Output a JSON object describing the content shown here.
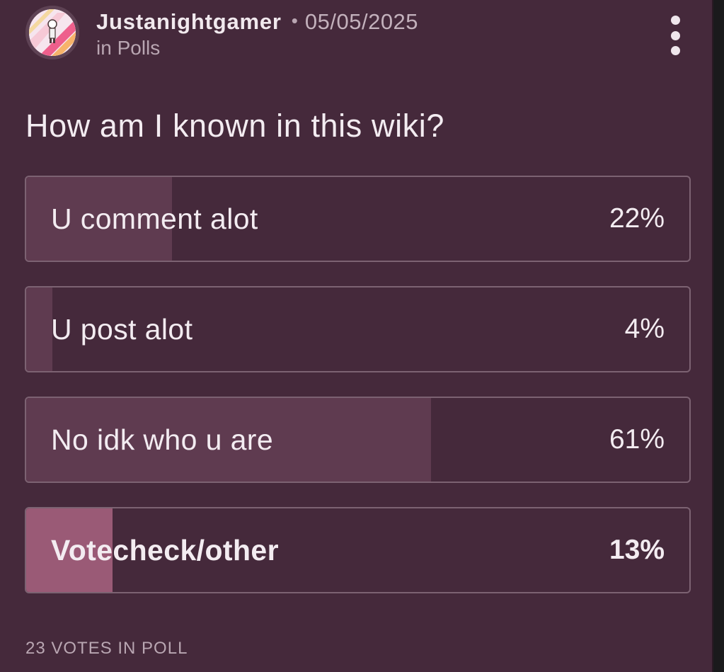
{
  "post": {
    "author": "Justanightgamer",
    "separator": "•",
    "date": "05/05/2025",
    "category": "in Polls"
  },
  "icons": {
    "avatar": "avatar-icon",
    "more": "more-options-icon"
  },
  "poll": {
    "question": "How am I known in this wiki?",
    "options": [
      {
        "label": "U comment alot",
        "percent_text": "22%",
        "percent": 22,
        "selected": false
      },
      {
        "label": "U post alot",
        "percent_text": "4%",
        "percent": 4,
        "selected": false
      },
      {
        "label": "No idk who u are",
        "percent_text": "61%",
        "percent": 61,
        "selected": false
      },
      {
        "label": "Votecheck/other",
        "percent_text": "13%",
        "percent": 13,
        "selected": true
      }
    ],
    "votes_text": "23 VOTES IN POLL"
  },
  "colors": {
    "card_background": "#45293b",
    "bar_fill": "#5f3b50",
    "selected_fill": "#9a5a76",
    "text": "#f3ecf1"
  }
}
